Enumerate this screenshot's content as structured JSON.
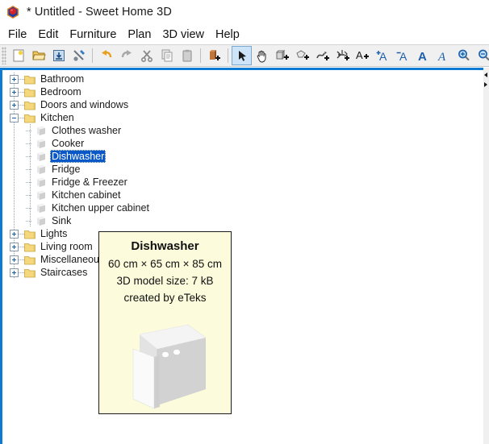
{
  "window": {
    "title": "* Untitled - Sweet Home 3D",
    "logo_icon": "sweet-home-3d-logo"
  },
  "menubar": {
    "items": [
      {
        "label": "File"
      },
      {
        "label": "Edit"
      },
      {
        "label": "Furniture"
      },
      {
        "label": "Plan"
      },
      {
        "label": "3D view"
      },
      {
        "label": "Help"
      }
    ]
  },
  "toolbar": {
    "buttons": [
      {
        "icon": "new-home-icon",
        "name": "new-home-button",
        "selected": false
      },
      {
        "icon": "open-folder-icon",
        "name": "open-button",
        "selected": false
      },
      {
        "icon": "save-icon",
        "name": "save-button",
        "selected": false
      },
      {
        "icon": "preferences-tools-icon",
        "name": "preferences-button",
        "selected": false
      },
      {
        "icon": "separator",
        "name": "toolbar-separator-1",
        "selected": false
      },
      {
        "icon": "undo-arrow-icon",
        "name": "undo-button",
        "selected": false
      },
      {
        "icon": "redo-arrow-icon",
        "name": "redo-button",
        "selected": false
      },
      {
        "icon": "cut-scissors-icon",
        "name": "cut-button",
        "selected": false
      },
      {
        "icon": "copy-icon",
        "name": "copy-button",
        "selected": false
      },
      {
        "icon": "paste-clipboard-icon",
        "name": "paste-button",
        "selected": false
      },
      {
        "icon": "separator",
        "name": "toolbar-separator-2",
        "selected": false
      },
      {
        "icon": "add-furniture-icon",
        "name": "add-furniture-button",
        "selected": false
      },
      {
        "icon": "separator",
        "name": "toolbar-separator-3",
        "selected": false
      },
      {
        "icon": "select-arrow-icon",
        "name": "select-mode-button",
        "selected": true
      },
      {
        "icon": "pan-hand-icon",
        "name": "pan-mode-button",
        "selected": false
      },
      {
        "icon": "create-walls-icon",
        "name": "create-walls-button",
        "selected": false
      },
      {
        "icon": "create-room-icon",
        "name": "create-rooms-button",
        "selected": false
      },
      {
        "icon": "create-polyline-icon",
        "name": "create-polylines-button",
        "selected": false
      },
      {
        "icon": "create-dimension-icon",
        "name": "create-dimensions-button",
        "selected": false
      },
      {
        "icon": "add-text-icon",
        "name": "add-texts-button",
        "selected": false
      },
      {
        "icon": "increase-text-size-icon",
        "name": "increase-text-size-button",
        "selected": false
      },
      {
        "icon": "decrease-text-size-icon",
        "name": "decrease-text-size-button",
        "selected": false
      },
      {
        "icon": "bold-text-icon",
        "name": "bold-button",
        "selected": false
      },
      {
        "icon": "italic-text-icon",
        "name": "italic-button",
        "selected": false
      },
      {
        "icon": "zoom-in-icon",
        "name": "zoom-in-button",
        "selected": false
      },
      {
        "icon": "zoom-out-icon",
        "name": "zoom-out-button",
        "selected": false
      },
      {
        "icon": "separator",
        "name": "toolbar-separator-4",
        "selected": false
      },
      {
        "icon": "photo-camera-icon",
        "name": "create-photo-button",
        "selected": false
      },
      {
        "icon": "video-camera-icon",
        "name": "create-video-button",
        "selected": false
      }
    ]
  },
  "furniture_catalog": {
    "tree": [
      {
        "label": "Bathroom",
        "type": "category",
        "expanded": false,
        "selected": false
      },
      {
        "label": "Bedroom",
        "type": "category",
        "expanded": false,
        "selected": false
      },
      {
        "label": "Doors and windows",
        "type": "category",
        "expanded": false,
        "selected": false
      },
      {
        "label": "Kitchen",
        "type": "category",
        "expanded": true,
        "selected": false
      },
      {
        "label": "Clothes washer",
        "type": "item",
        "icon": "clothes-washer-icon",
        "selected": false
      },
      {
        "label": "Cooker",
        "type": "item",
        "icon": "cooker-icon",
        "selected": false
      },
      {
        "label": "Dishwasher",
        "type": "item",
        "icon": "dishwasher-icon",
        "selected": true
      },
      {
        "label": "Fridge",
        "type": "item",
        "icon": "fridge-icon",
        "selected": false
      },
      {
        "label": "Fridge & Freezer",
        "type": "item",
        "icon": "fridge-freezer-icon",
        "selected": false
      },
      {
        "label": "Kitchen cabinet",
        "type": "item",
        "icon": "kitchen-cabinet-icon",
        "selected": false
      },
      {
        "label": "Kitchen upper cabinet",
        "type": "item",
        "icon": "kitchen-upper-cabinet-icon",
        "selected": false
      },
      {
        "label": "Sink",
        "type": "item",
        "icon": "sink-icon",
        "selected": false
      },
      {
        "label": "Lights",
        "type": "category",
        "expanded": false,
        "selected": false
      },
      {
        "label": "Living room",
        "type": "category",
        "expanded": false,
        "selected": false
      },
      {
        "label": "Miscellaneous",
        "type": "category",
        "expanded": false,
        "selected": false
      },
      {
        "label": "Staircases",
        "type": "category",
        "expanded": false,
        "selected": false
      }
    ]
  },
  "tooltip": {
    "title": "Dishwasher",
    "dimensions": "60 cm × 65 cm × 85 cm",
    "model_size": "3D model size: 7 kB",
    "creator": "created by eTeks",
    "preview_icon": "dishwasher-3d-preview"
  },
  "split_pane": {
    "expand_up_icon": "collapse-left-arrow-icon",
    "expand_down_icon": "collapse-right-arrow-icon"
  },
  "colors": {
    "selection_blue": "#0a58c8",
    "pane_border_blue": "#0d7ad4",
    "tooltip_background": "#fcfbdc",
    "toolbar_background": "#f0f0f0",
    "folder_yellow": "#f5d77e"
  }
}
